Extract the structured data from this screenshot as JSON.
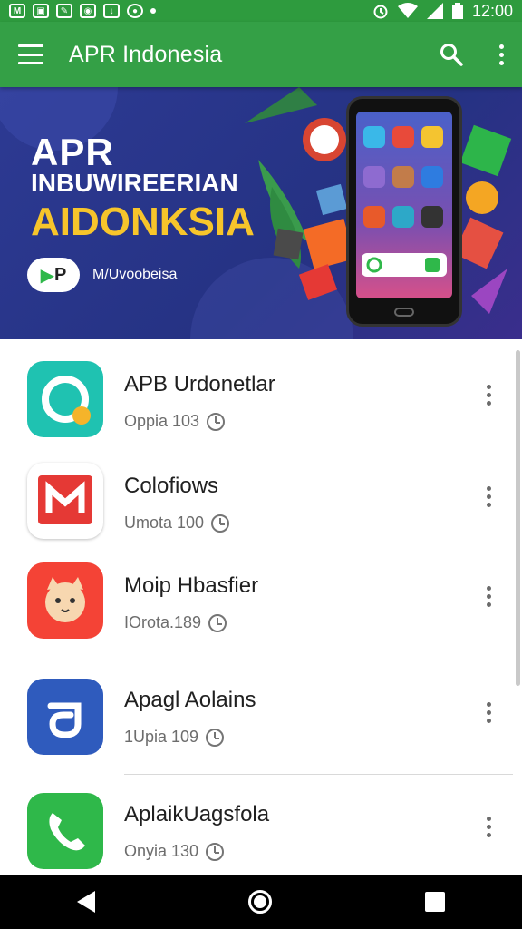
{
  "status_bar": {
    "time": "12:00",
    "left_icons": [
      "gmail-icon",
      "image-icon",
      "edit-icon",
      "camera-icon",
      "download-icon",
      "record-icon"
    ],
    "right_icons": [
      "alarm-icon",
      "wifi-icon",
      "signal-icon",
      "battery-icon"
    ]
  },
  "app_bar": {
    "title": "APR Indonesia",
    "icons": [
      "menu-icon",
      "search-icon",
      "more-vert-icon"
    ]
  },
  "banner": {
    "title": "APR",
    "subtitle": "INBUWIREERIAN",
    "accent_text": "AIDONKSIA",
    "brand_logo": "P",
    "brand_text": "M/Uvoobeisa"
  },
  "apps": [
    {
      "name": "APB Urdonetlar",
      "meta": "Oppia 103",
      "icon": "teal-search-app-icon",
      "color": "#1fc2b1"
    },
    {
      "name": "Colofiows",
      "meta": "Umota 100",
      "icon": "red-mail-app-icon",
      "color": "#e53935"
    },
    {
      "name": "Moip Hbasfier",
      "meta": "IOrota.189",
      "icon": "cat-app-icon",
      "color": "#f44336"
    },
    {
      "name": "Apagl Aolains",
      "meta": "1Upia 109",
      "icon": "blue-app-icon",
      "color": "#2f5bbd"
    },
    {
      "name": "AplaikUagsfola",
      "meta": "Onyia 130",
      "icon": "phone-app-icon",
      "color": "#2fb84a"
    }
  ],
  "colors": {
    "status_bar": "#2e9b3e",
    "app_bar": "#34a046",
    "banner_bg": "#2d3a93",
    "accent_yellow": "#f7c52b",
    "nav_bar": "#000000"
  },
  "nav_bar": {
    "icons": [
      "back-icon",
      "home-icon",
      "recents-icon"
    ]
  }
}
